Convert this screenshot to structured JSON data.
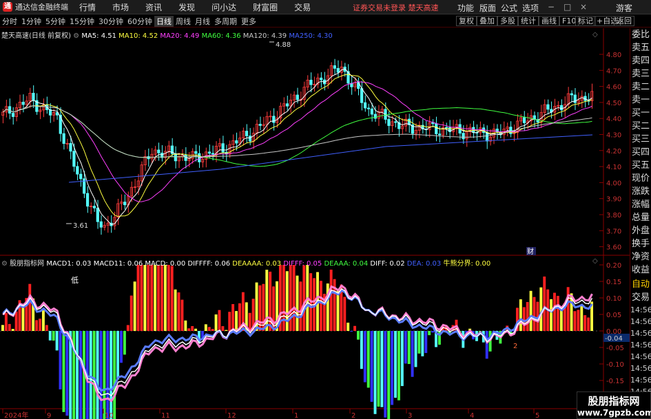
{
  "app": {
    "logo": "通",
    "title": "通达信金融终端"
  },
  "menu": [
    "行情",
    "市场",
    "资讯",
    "发现",
    "问小达",
    "财富圈",
    "交易"
  ],
  "login_warning": "证券交易未登录 楚天高速",
  "menu_right": [
    "功能",
    "版面",
    "公式",
    "选项"
  ],
  "guest": "游客",
  "window_controls": [
    "−",
    "□",
    "×"
  ],
  "periods": [
    "分时",
    "1分钟",
    "5分钟",
    "15分钟",
    "30分钟",
    "60分钟",
    "日线",
    "周线",
    "月线",
    "多周期",
    "更多"
  ],
  "active_period": "日线",
  "toolbar_buttons": [
    "复权",
    "叠加",
    "多股",
    "统计",
    "画线",
    "F10",
    "标记",
    "+自选",
    "返回"
  ],
  "main": {
    "title": "楚天高速(日线 前复权)",
    "legend": [
      {
        "label": "MA5: 4.51",
        "color": "#ffffff"
      },
      {
        "label": "MA10: 4.52",
        "color": "#ffff40"
      },
      {
        "label": "MA20: 4.49",
        "color": "#ff40ff"
      },
      {
        "label": "MA60: 4.36",
        "color": "#40ff40"
      },
      {
        "label": "MA120: 4.39",
        "color": "#c8c8c8"
      },
      {
        "label": "MA250: 4.30",
        "color": "#4060ff"
      }
    ],
    "high_label": "4.88",
    "low_label": "3.61",
    "cai_label": "财",
    "y_ticks": [
      "4.80",
      "4.70",
      "4.60",
      "4.50",
      "4.40",
      "4.30",
      "4.20",
      "4.10",
      "4.00",
      "3.90",
      "3.80",
      "3.70",
      "3.60"
    ]
  },
  "sub": {
    "title": "股朋指标网",
    "legend": [
      {
        "label": "MACD1: 0.03",
        "color": "#ffffff"
      },
      {
        "label": "MACD11: 0.06",
        "color": "#ffffff"
      },
      {
        "label": "MACD: 0.00",
        "color": "#ffffff"
      },
      {
        "label": "DIFFFF: 0.06",
        "color": "#ffffff"
      },
      {
        "label": "DEAAAA: 0.03",
        "color": "#ffff40"
      },
      {
        "label": "DIFFF: 0.05",
        "color": "#ff40ff"
      },
      {
        "label": "DEAAA: 0.04",
        "color": "#40ff40"
      },
      {
        "label": "DIFF: 0.02",
        "color": "#ffffff"
      },
      {
        "label": "DEA: 0.03",
        "color": "#4060ff"
      },
      {
        "label": "牛熊分界: 0.00",
        "color": "#ffff40"
      }
    ],
    "di_label": "低",
    "y_ticks": [
      "0.20",
      "0.15",
      "0.10",
      "0.05",
      "0.00",
      "-0.05",
      "-0.10",
      "-0.15"
    ],
    "current_value": "-0.04",
    "marker_2": "2"
  },
  "x_axis": [
    "2024年",
    "9",
    "10",
    "11",
    "12",
    "1",
    "2",
    "3",
    "4",
    "5"
  ],
  "right_panel": {
    "items": [
      "委比",
      "卖五",
      "卖四",
      "卖三",
      "卖二",
      "卖一",
      "买一",
      "买二",
      "买三",
      "买四",
      "买五",
      "现价",
      "涨跌",
      "涨幅",
      "总量",
      "外盘",
      "换手",
      "净资",
      "收益"
    ],
    "lower": [
      "自动",
      "交易"
    ],
    "times": [
      "14:56",
      "14:56",
      "14:56",
      "14:56",
      "14:56",
      "14:56",
      "14:56",
      "14:56",
      "14:56",
      "14:56"
    ]
  },
  "watermark": {
    "line1": "股朋指标网",
    "line2": "www.7gpzb.com"
  }
}
